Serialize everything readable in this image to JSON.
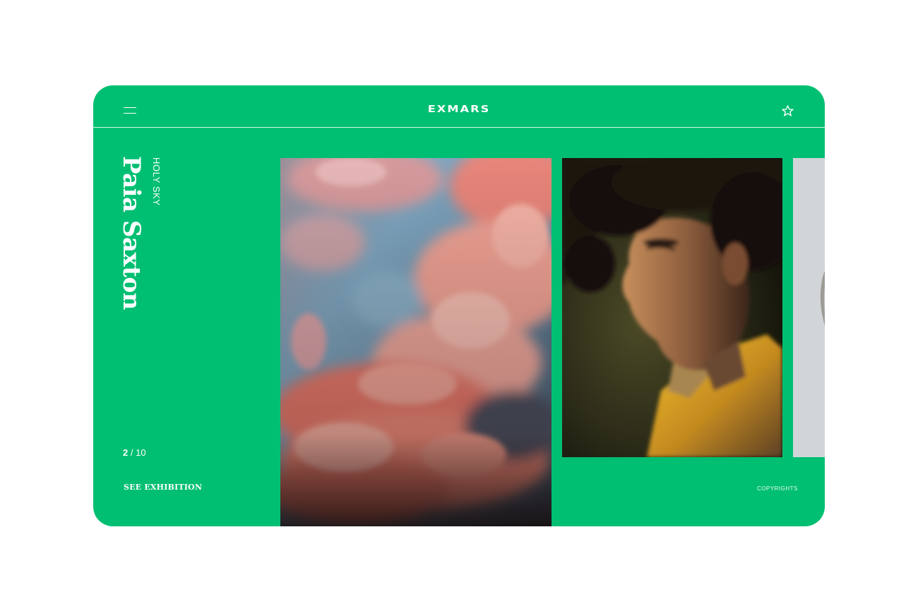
{
  "header": {
    "brand": "EXMARS",
    "menu_icon": "hamburger-menu-icon",
    "favorite_icon": "star-outline-icon"
  },
  "exhibition": {
    "subtitle": "HOLY SKY",
    "artist": "Paia Saxton",
    "cta_label": "SEE EXHIBITION"
  },
  "pagination": {
    "current": "2",
    "separator": "/",
    "total": "10"
  },
  "footer": {
    "copyright": "COPYRIGHTS"
  },
  "gallery": {
    "images": [
      {
        "name": "pink-clouds-sky-photo"
      },
      {
        "name": "young-man-portrait-photo"
      },
      {
        "name": "sculpture-partial-photo"
      }
    ]
  },
  "colors": {
    "background": "#00BF72",
    "text": "#FFFFFF",
    "page": "#FFFFFF"
  }
}
